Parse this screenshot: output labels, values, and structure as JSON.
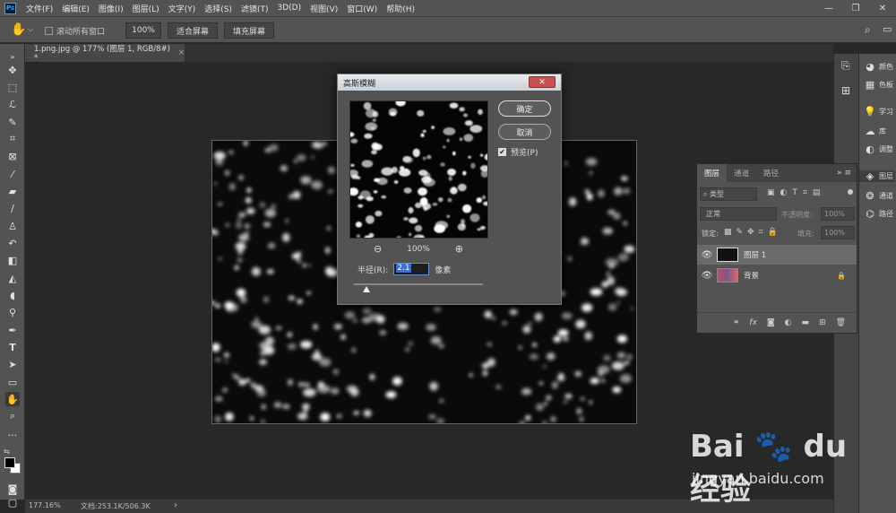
{
  "menubar": {
    "logo": "Ps",
    "items": [
      "文件(F)",
      "编辑(E)",
      "图像(I)",
      "图层(L)",
      "文字(Y)",
      "选择(S)",
      "滤镜(T)",
      "3D(D)",
      "视图(V)",
      "窗口(W)",
      "帮助(H)"
    ]
  },
  "options": {
    "scroll_all_label": "滚动所有窗口",
    "zoom_value": "100%",
    "fit_screen": "适合屏幕",
    "fill_screen": "填充屏幕"
  },
  "document_tab": {
    "label": "1.png.jpg @ 177% (图层 1, RGB/8#) *",
    "close": "×"
  },
  "status": {
    "zoom": "177.16%",
    "doc_info": "文档:253.1K/506.3K",
    "arrow": "›"
  },
  "dock": {
    "items": [
      "颜色",
      "色板",
      "学习",
      "库",
      "调整",
      "图层",
      "通道",
      "路径"
    ]
  },
  "layers_panel": {
    "tabs": [
      "图层",
      "通道",
      "路径"
    ],
    "filter_kind": "类型",
    "blend_mode": "正常",
    "opacity_label": "不透明度:",
    "opacity_value": "100%",
    "lock_label": "锁定:",
    "fill_label": "填充:",
    "fill_value": "100%",
    "layers": [
      {
        "name": "图层 1"
      },
      {
        "name": "背景"
      }
    ],
    "footer_icons": [
      "link-icon",
      "fx-icon",
      "mask-icon",
      "adjustment-icon",
      "folder-icon",
      "new-layer-icon",
      "trash-icon"
    ]
  },
  "dialog": {
    "title": "高斯模糊",
    "close": "✕",
    "ok_label": "确定",
    "cancel_label": "取消",
    "preview_label": "预览(P)",
    "preview_checked": true,
    "zoom_value": "100%",
    "radius_label": "半径(R):",
    "radius_value": "2.1",
    "radius_unit": "像素",
    "slider_fraction": 0.1
  },
  "watermark": {
    "logo": "Bai 🐾 du 经验",
    "url": "jingyan.baidu.com"
  },
  "colors": {
    "accent": "#31a8ff",
    "panel_bg": "#535353",
    "workspace_bg": "#282828",
    "close_red": "#c75050"
  }
}
